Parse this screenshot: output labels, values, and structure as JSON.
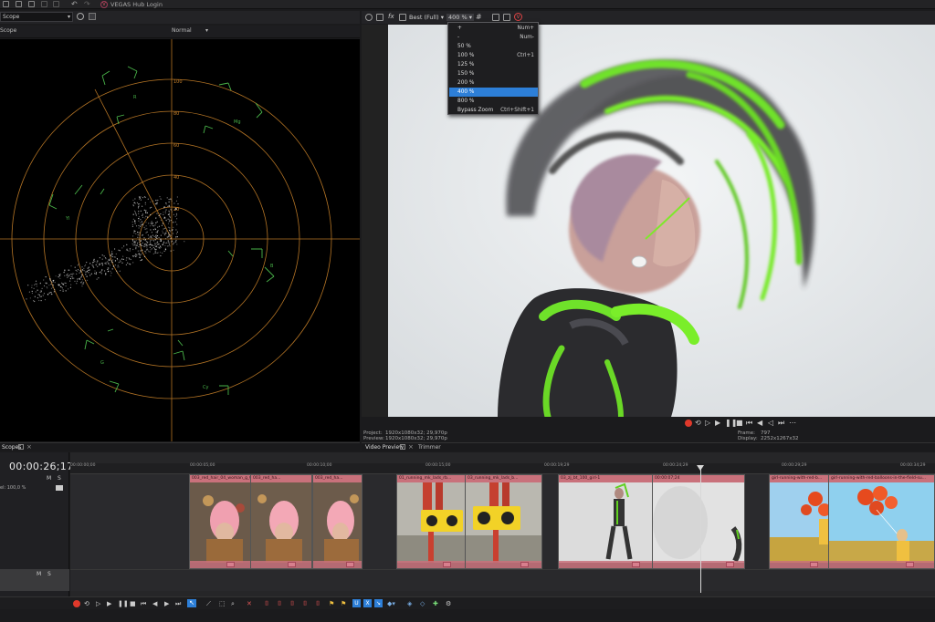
{
  "titlebar": {
    "hub_label": "VEGAS Hub Login",
    "hub_logo": "V"
  },
  "scope": {
    "selector": "Scope",
    "sub_label": "Scope",
    "mode": "Normal",
    "tab_label": "Scopes",
    "ring_labels": [
      "100",
      "80",
      "60",
      "40",
      "20"
    ],
    "target_labels": [
      "R",
      "Mg",
      "B",
      "Cy",
      "G",
      "Yl"
    ],
    "accent_color": "#d68a2a",
    "target_color": "#49b449"
  },
  "preview": {
    "quality": "Best (Full)",
    "zoom": "400 %",
    "tabs": [
      "Video Preview",
      "Trimmer"
    ],
    "project_label": "Project:",
    "project_value": "1920x1080x32; 29,970p",
    "preview_label": "Preview:",
    "preview_value": "1920x1080x32; 29,970p",
    "frame_label": "Frame:",
    "frame_value": "797",
    "display_label": "Display:",
    "display_value": "2252x1267x32"
  },
  "zoom_menu": {
    "items": [
      {
        "label": "+",
        "shortcut": "Num+"
      },
      {
        "label": "-",
        "shortcut": "Num-"
      },
      {
        "label": "50 %",
        "shortcut": ""
      },
      {
        "label": "100 %",
        "shortcut": "Ctrl+1"
      },
      {
        "label": "125 %",
        "shortcut": ""
      },
      {
        "label": "150 %",
        "shortcut": ""
      },
      {
        "label": "200 %",
        "shortcut": ""
      },
      {
        "label": "400 %",
        "shortcut": ""
      },
      {
        "label": "800 %",
        "shortcut": ""
      },
      {
        "label": "Bypass Zoom",
        "shortcut": "Ctrl+Shift+1"
      }
    ],
    "selected": "400 %"
  },
  "timeline": {
    "timecode": "00:00:26;17",
    "level_label": "el: 100,0 %",
    "track_buttons": [
      "M",
      "S"
    ],
    "ruler_marks": [
      "00:00:00;00",
      "00:00:05;00",
      "00:00:10;00",
      "00:00:15;00",
      "00:00:19;29",
      "00:00:24;29",
      "00:00:29;29",
      "00:00:34;29"
    ],
    "clips": [
      {
        "name": "003_red_hair_04_woman_g_0...",
        "kind": "pink-hair"
      },
      {
        "name": "003_red_ha...",
        "kind": "pink-hair"
      },
      {
        "name": "003_red_ha...",
        "kind": "pink-hair"
      },
      {
        "name": "01_running_mk_lads_rb...",
        "kind": "boombox"
      },
      {
        "name": "03_running_mk_lads_b...",
        "kind": "boombox"
      },
      {
        "name": "03_zj_bt_100_girl-1",
        "kind": "dancer"
      },
      {
        "name": "00:00:07;24",
        "kind": "dancer"
      },
      {
        "name": "girl-running-with-red-b...",
        "kind": "balloons"
      },
      {
        "name": "girl-running-with-red-balloons-in-the-field-su...",
        "kind": "balloons"
      }
    ],
    "brand_red": "#e0392b",
    "clip_header_color": "#c9717b"
  }
}
